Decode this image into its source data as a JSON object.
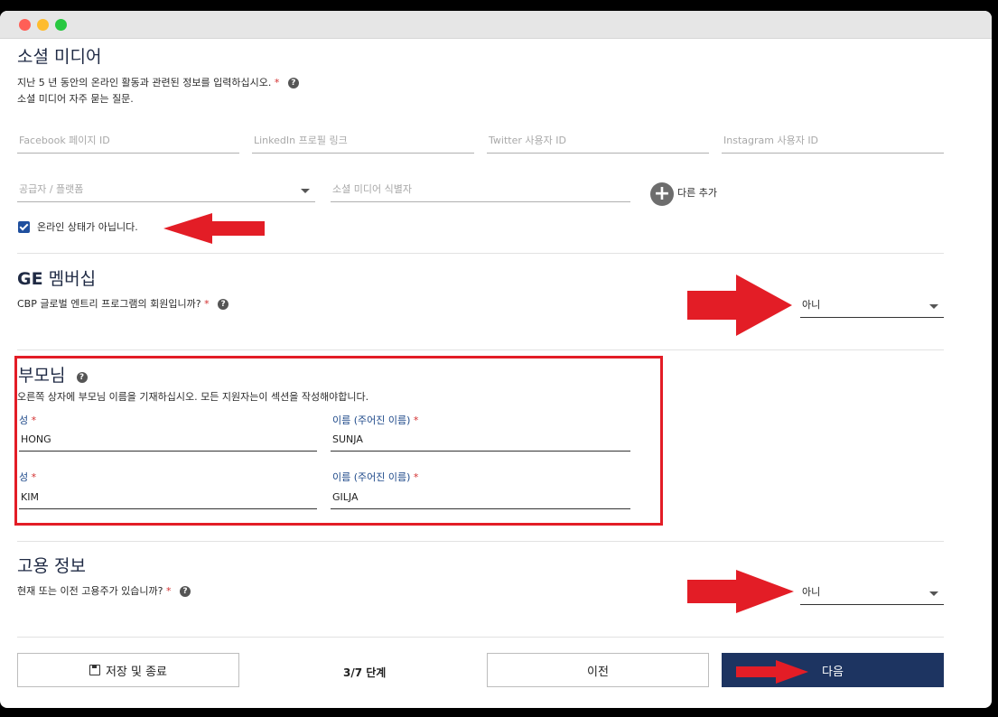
{
  "social": {
    "title": "소셜 미디어",
    "desc": "지난 5 년 동안의 온라인 활동과 관련된 정보를 입력하십시오.",
    "faq": "소셜 미디어 자주 묻는 질문.",
    "fields": {
      "facebook": "Facebook 페이지 ID",
      "linkedin": "LinkedIn 프로필 링크",
      "twitter": "Twitter 사용자 ID",
      "instagram": "Instagram 사용자 ID",
      "provider": "공급자 / 플랫폼",
      "identifier": "소셜 미디어 식별자"
    },
    "add_label": "다른 추가",
    "not_online_label": "온라인 상태가 아닙니다.",
    "not_online_checked": true
  },
  "ge": {
    "title_bold": "GE",
    "title_rest": "멤버십",
    "question": "CBP 글로벌 엔트리 프로그램의 회원입니까?",
    "answer": "아니"
  },
  "parents": {
    "title": "부모님",
    "desc": "오른쪽 상자에 부모님 이름을 기재하십시오. 모든 지원자는이 섹션을 작성해야합니다.",
    "surname_label": "성",
    "given_label": "이름 (주어진 이름)",
    "rows": [
      {
        "surname": "HONG",
        "given": "SUNJA"
      },
      {
        "surname": "KIM",
        "given": "GILJA"
      }
    ]
  },
  "employment": {
    "title": "고용 정보",
    "question": "현재 또는 이전 고용주가 있습니까?",
    "answer": "아니"
  },
  "footer": {
    "save_label": "저장 및 종료",
    "step": "3/7 단계",
    "prev_label": "이전",
    "next_label": "다음"
  },
  "required_mark": "*",
  "help_glyph": "?",
  "colors": {
    "accent": "#1d3461",
    "annotation_red": "#e31d26",
    "required": "#d32f2f"
  }
}
